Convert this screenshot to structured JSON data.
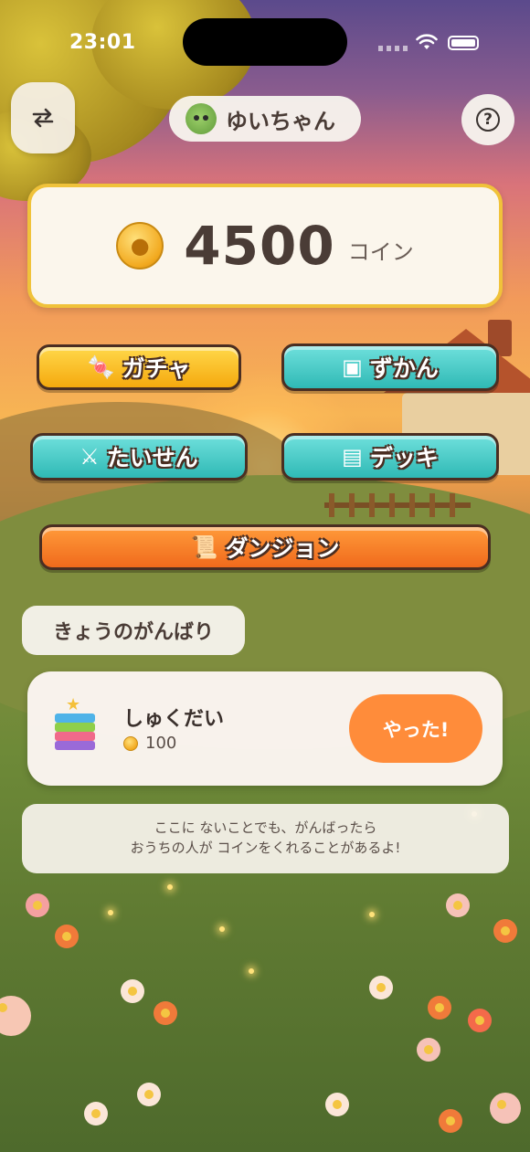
{
  "status_bar": {
    "time": "23:01"
  },
  "header": {
    "switch_icon": "swap-arrows-icon",
    "profile_name": "ゆいちゃん",
    "help_icon": "question-mark-icon"
  },
  "coins": {
    "value": "4500",
    "unit": "コイン",
    "icon": "paw-coin-icon"
  },
  "menu": {
    "gacha": {
      "label": "ガチャ",
      "icon": "gumball-machine-icon"
    },
    "zukan": {
      "label": "ずかん",
      "icon": "treasure-chest-icon"
    },
    "taisen": {
      "label": "たいせん",
      "icon": "crossed-swords-icon"
    },
    "deck": {
      "label": "デッキ",
      "icon": "cards-icon"
    },
    "dungeon": {
      "label": "ダンジョン",
      "icon": "scroll-map-icon"
    }
  },
  "today": {
    "section_label": "きょうのがんばり",
    "task": {
      "title": "しゅくだい",
      "reward": "100",
      "done_label": "やった!"
    },
    "hint_line1": "ここに ないことでも、がんばったら",
    "hint_line2": "おうちの人が コインをくれることがあるよ!"
  },
  "colors": {
    "accent_orange": "#ff8c3a",
    "coin_border": "#f0c23a",
    "teal_button": "#2fb9b5",
    "yellow_button": "#f5a90e"
  }
}
